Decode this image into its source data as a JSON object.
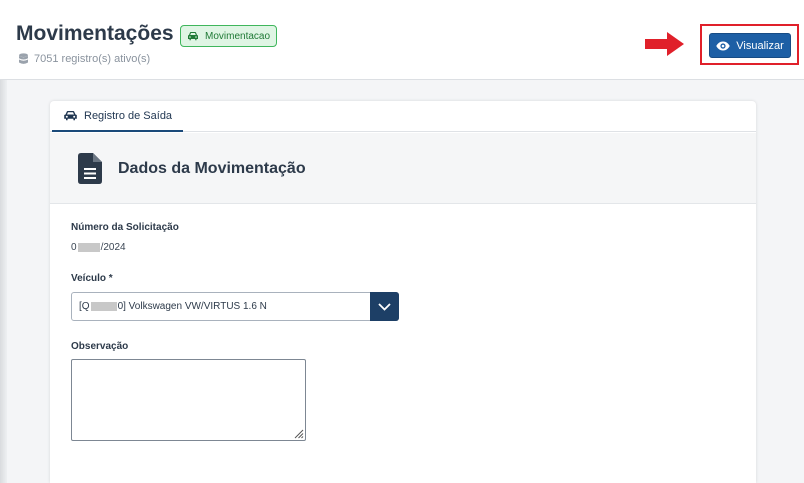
{
  "header": {
    "title": "Movimentações",
    "module_badge": "Movimentacao",
    "record_count": "7051 registro(s) ativo(s)",
    "view_button": "Visualizar"
  },
  "tabs": [
    {
      "label": "Registro de Saída",
      "active": true
    }
  ],
  "section": {
    "title": "Dados da Movimentação"
  },
  "form": {
    "request_number": {
      "label": "Número da Solicitação",
      "value_prefix": "0",
      "value_suffix": "/2024"
    },
    "vehicle": {
      "label": "Veículo *",
      "value_prefix": "[Q",
      "value_suffix": "0] Volkswagen VW/VIRTUS 1.6 N"
    },
    "observation": {
      "label": "Observação",
      "value": ""
    }
  },
  "colors": {
    "primary": "#1d5fa5",
    "dark_primary": "#1d3f66",
    "badge_green": "#3fb65c",
    "annotation_red": "#e0202a"
  },
  "icons": {
    "badge": "car-icon",
    "records": "database-icon",
    "view": "eye-icon",
    "tab": "car-icon",
    "section": "document-icon",
    "select": "chevron-down-icon"
  }
}
